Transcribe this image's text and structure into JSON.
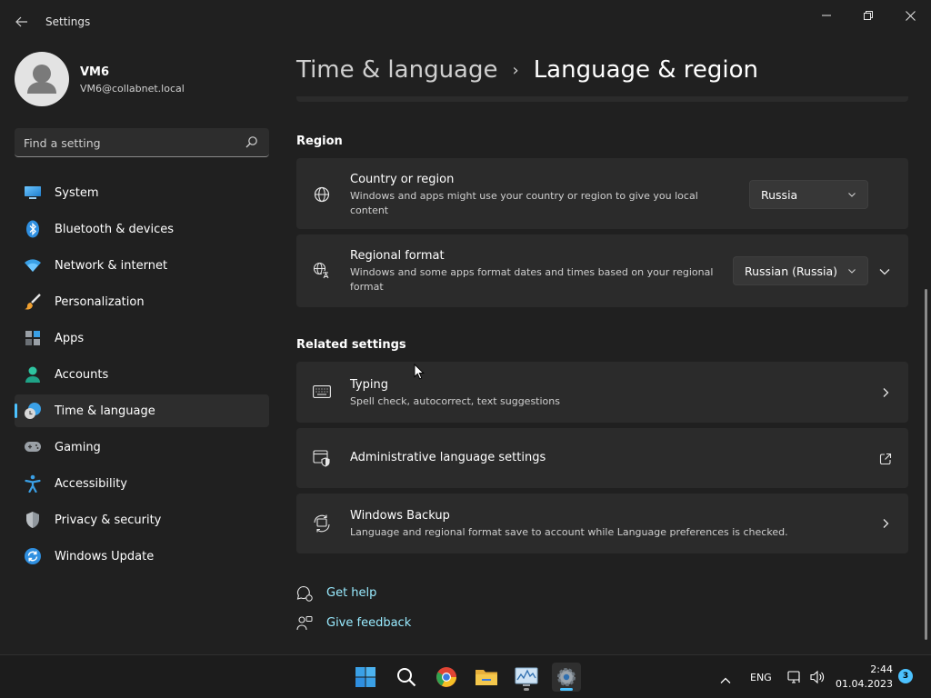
{
  "window": {
    "title": "Settings",
    "back_icon": "back-arrow-icon",
    "controls": [
      "minimize-icon",
      "maximize-icon",
      "close-icon"
    ]
  },
  "user": {
    "name": "VM6",
    "email": "VM6@collabnet.local"
  },
  "search": {
    "placeholder": "Find a setting"
  },
  "sidebar": {
    "items": [
      {
        "label": "System",
        "icon": "system-icon",
        "active": false
      },
      {
        "label": "Bluetooth & devices",
        "icon": "bluetooth-icon",
        "active": false
      },
      {
        "label": "Network & internet",
        "icon": "wifi-icon",
        "active": false
      },
      {
        "label": "Personalization",
        "icon": "brush-icon",
        "active": false
      },
      {
        "label": "Apps",
        "icon": "apps-icon",
        "active": false
      },
      {
        "label": "Accounts",
        "icon": "accounts-icon",
        "active": false
      },
      {
        "label": "Time & language",
        "icon": "time-language-icon",
        "active": true
      },
      {
        "label": "Gaming",
        "icon": "gamepad-icon",
        "active": false
      },
      {
        "label": "Accessibility",
        "icon": "accessibility-icon",
        "active": false
      },
      {
        "label": "Privacy & security",
        "icon": "shield-icon",
        "active": false
      },
      {
        "label": "Windows Update",
        "icon": "update-icon",
        "active": false
      }
    ]
  },
  "header": {
    "parent": "Time & language",
    "separator": "›",
    "current": "Language & region"
  },
  "region": {
    "title": "Region",
    "country": {
      "title": "Country or region",
      "description_line1": "Windows and apps might use your country or region to give you local",
      "description_line2": "content",
      "value": "Russia"
    },
    "format": {
      "title": "Regional format",
      "description_line1": "Windows and some apps format dates and times based on your regional",
      "description_line2": "format",
      "value": "Russian (Russia)"
    }
  },
  "related": {
    "title": "Related settings",
    "typing": {
      "title": "Typing",
      "description": "Spell check, autocorrect, text suggestions"
    },
    "admin": {
      "title": "Administrative language settings"
    },
    "backup": {
      "title": "Windows Backup",
      "description": "Language and regional format save to account while Language preferences is checked."
    }
  },
  "help": {
    "get_help": "Get help",
    "give_feedback": "Give feedback"
  },
  "taskbar": {
    "apps": [
      "windows-start-icon",
      "search-icon",
      "chrome-icon",
      "file-explorer-icon",
      "resource-monitor-icon",
      "settings-gear-icon"
    ],
    "language": "ENG",
    "time": "2:44",
    "date": "01.04.2023",
    "notifications": "3"
  },
  "colors": {
    "accent": "#4cc2ff",
    "link": "#99ebff",
    "background": "#202020",
    "card": "#2b2b2b"
  }
}
